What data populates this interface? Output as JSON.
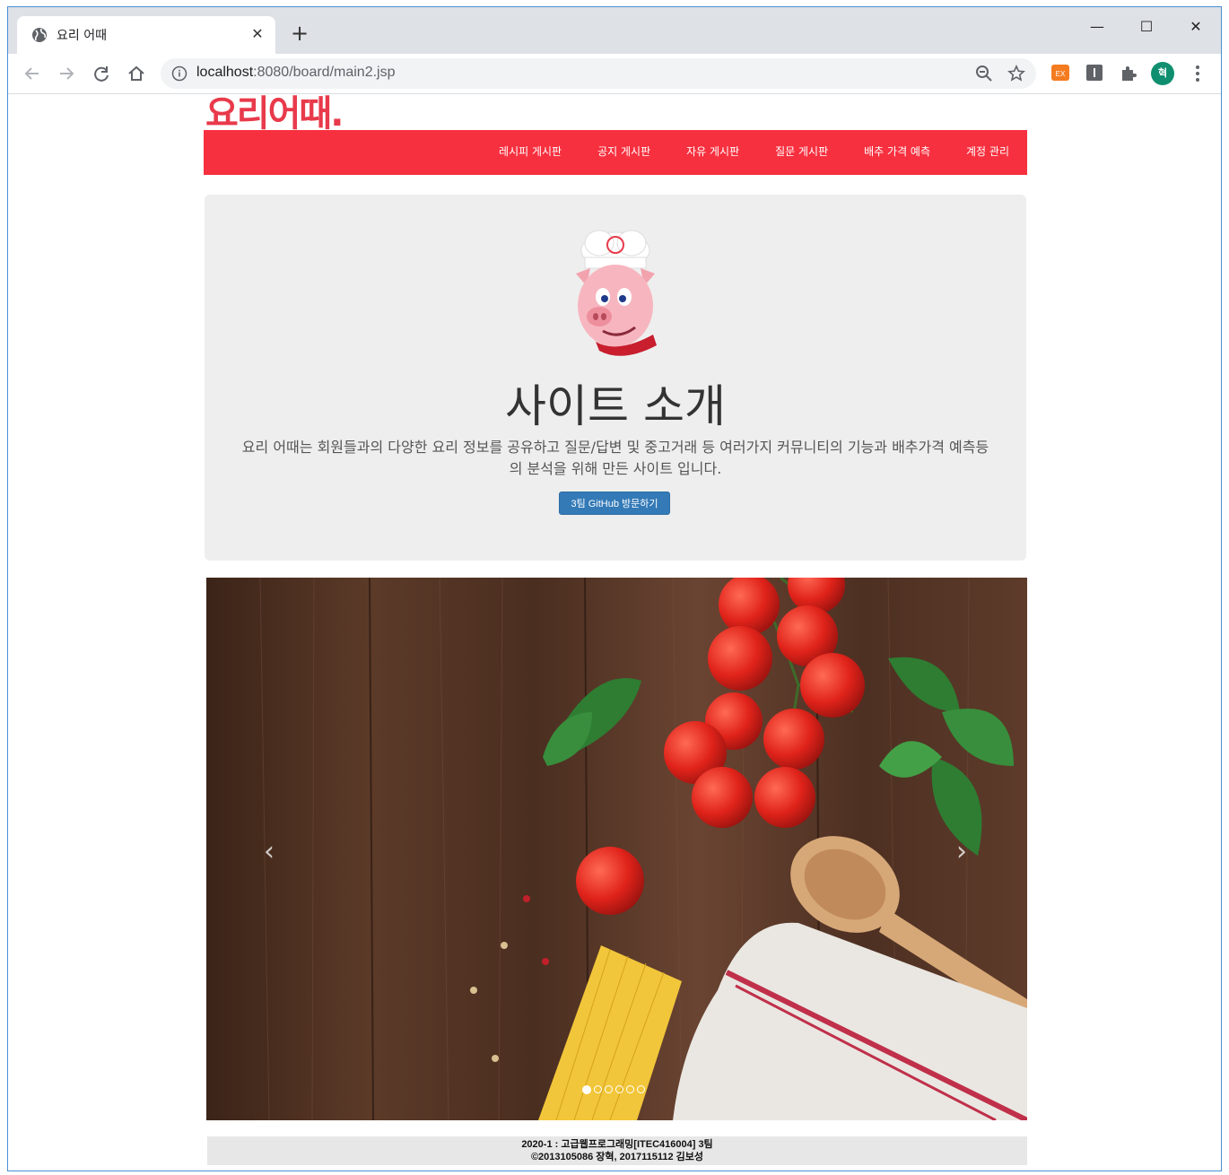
{
  "browser": {
    "tab_title": "요리 어때",
    "tab_close": "✕",
    "new_tab": "+",
    "url_host": "localhost",
    "url_path": ":8080/board/main2.jsp",
    "window_controls": {
      "minimize": "—",
      "maximize": "☐",
      "close": "✕"
    },
    "avatar_initial": "혁",
    "ext_label": "EX"
  },
  "site": {
    "logo": "요리어때.",
    "nav": [
      "레시피 게시판",
      "공지 게시판",
      "자유 게시판",
      "질문 게시판",
      "배추 가격 예측",
      "계정 관리"
    ],
    "jumbotron": {
      "title": "사이트 소개",
      "description": "요리 어때는 회원들과의 다양한 요리 정보를 공유하고 질문/답변 및 중고거래 등 여러가지 커뮤니티의 기능과 배추가격 예측등의 분석을 위해 만든 사이트 입니다.",
      "button": "3팀 GitHub 방문하기"
    },
    "carousel": {
      "slide_count": 6,
      "active_index": 0,
      "prev": "‹",
      "next": "›"
    },
    "footer": {
      "line1": "2020-1 : 고급웹프로그래밍[ITEC416004] 3팀",
      "line2": "©2013105086 장혁, 2017115112 김보성"
    }
  },
  "colors": {
    "brand": "#f7303f",
    "button": "#337ab7",
    "jumbotron": "#eeeeee"
  }
}
